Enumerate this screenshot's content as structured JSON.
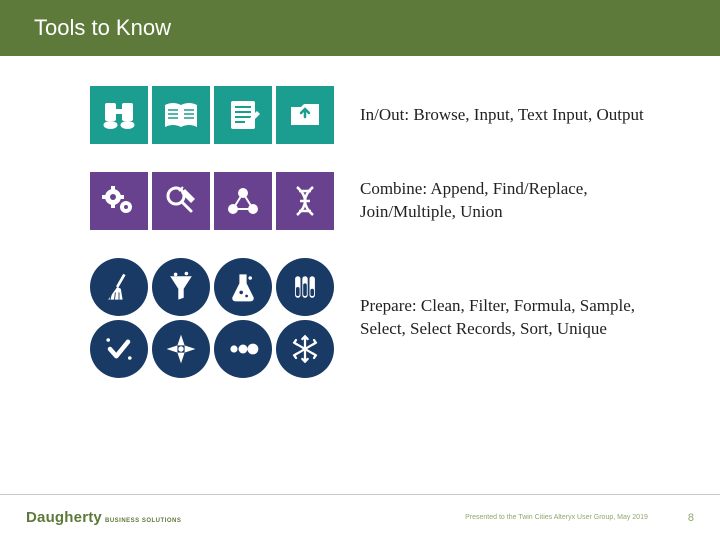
{
  "header": {
    "title": "Tools to Know"
  },
  "rows": [
    {
      "desc": "In/Out: Browse, Input, Text Input, Output",
      "color": "teal",
      "icons": [
        "binoculars-icon",
        "book-open-icon",
        "form-icon",
        "folder-out-icon"
      ]
    },
    {
      "desc": "Combine: Append, Find/Replace, Join/Multiple, Union",
      "color": "purple",
      "icons": [
        "gears-icon",
        "pencil-search-icon",
        "molecule-icon",
        "dna-icon"
      ]
    },
    {
      "desc": "Prepare: Clean, Filter, Formula, Sample, Select, Select Records, Sort, Unique",
      "color": "navy",
      "icons": [
        "broom-icon",
        "funnel-icon",
        "flask-icon",
        "tubes-icon",
        "check-select-icon",
        "crosshair-icon",
        "dots-sort-icon",
        "snowflake-icon"
      ]
    }
  ],
  "footer": {
    "brand": "Daugherty",
    "brand_sub": "BUSINESS SOLUTIONS",
    "note": "Presented to the Twin Cities Alteryx User Group, May 2019",
    "page": "8"
  }
}
